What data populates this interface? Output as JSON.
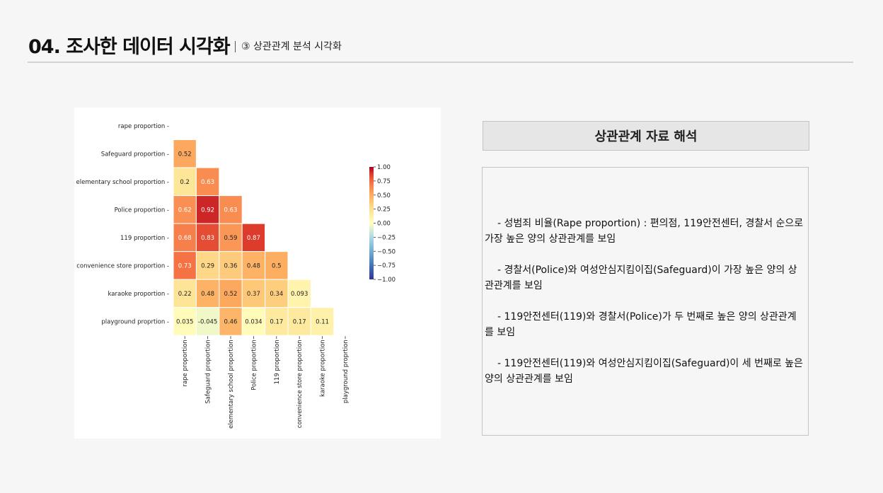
{
  "header": {
    "title": "04. 조사한 데이터 시각화",
    "subtitle": "③ 상관관계 분석 시각화"
  },
  "interpretation": {
    "heading": "상관관계 자료 해석",
    "notes": [
      "-  성범죄 비율(Rape proportion) : 편의점, 119안전센터, 경찰서 순으로 가장 높은 양의 상관관계를 보임",
      "-  경찰서(Police)와 여성안심지킴이집(Safeguard)이 가장 높은 양의 상관관계를 보임",
      "-  119안전센터(119)와 경찰서(Police)가 두 번째로 높은 양의 상관관계를 보임",
      "-  119안전센터(119)와 여성안심지킴이집(Safeguard)이 세 번째로 높은 양의 상관관계를 보임"
    ]
  },
  "chart_data": {
    "type": "heatmap",
    "title": "",
    "variables": [
      "rape proportion",
      "Safeguard proportion",
      "elementary school proportion",
      "Police proportion",
      "119 proportion",
      "convenience store proportion",
      "karaoke proportion",
      "playground proprtion"
    ],
    "cells": [
      {
        "row": 1,
        "col": 0,
        "value": 0.52,
        "label": "0.52"
      },
      {
        "row": 2,
        "col": 0,
        "value": 0.2,
        "label": "0.2"
      },
      {
        "row": 2,
        "col": 1,
        "value": 0.63,
        "label": "0.63"
      },
      {
        "row": 3,
        "col": 0,
        "value": 0.62,
        "label": "0.62"
      },
      {
        "row": 3,
        "col": 1,
        "value": 0.92,
        "label": "0.92"
      },
      {
        "row": 3,
        "col": 2,
        "value": 0.63,
        "label": "0.63"
      },
      {
        "row": 4,
        "col": 0,
        "value": 0.68,
        "label": "0.68"
      },
      {
        "row": 4,
        "col": 1,
        "value": 0.83,
        "label": "0.83"
      },
      {
        "row": 4,
        "col": 2,
        "value": 0.59,
        "label": "0.59"
      },
      {
        "row": 4,
        "col": 3,
        "value": 0.87,
        "label": "0.87"
      },
      {
        "row": 5,
        "col": 0,
        "value": 0.73,
        "label": "0.73"
      },
      {
        "row": 5,
        "col": 1,
        "value": 0.29,
        "label": "0.29"
      },
      {
        "row": 5,
        "col": 2,
        "value": 0.36,
        "label": "0.36"
      },
      {
        "row": 5,
        "col": 3,
        "value": 0.48,
        "label": "0.48"
      },
      {
        "row": 5,
        "col": 4,
        "value": 0.5,
        "label": "0.5"
      },
      {
        "row": 6,
        "col": 0,
        "value": 0.22,
        "label": "0.22"
      },
      {
        "row": 6,
        "col": 1,
        "value": 0.48,
        "label": "0.48"
      },
      {
        "row": 6,
        "col": 2,
        "value": 0.52,
        "label": "0.52"
      },
      {
        "row": 6,
        "col": 3,
        "value": 0.37,
        "label": "0.37"
      },
      {
        "row": 6,
        "col": 4,
        "value": 0.34,
        "label": "0.34"
      },
      {
        "row": 6,
        "col": 5,
        "value": 0.093,
        "label": "0.093"
      },
      {
        "row": 7,
        "col": 0,
        "value": 0.035,
        "label": "0.035"
      },
      {
        "row": 7,
        "col": 1,
        "value": -0.045,
        "label": "-0.045"
      },
      {
        "row": 7,
        "col": 2,
        "value": 0.46,
        "label": "0.46"
      },
      {
        "row": 7,
        "col": 3,
        "value": 0.034,
        "label": "0.034"
      },
      {
        "row": 7,
        "col": 4,
        "value": 0.17,
        "label": "0.17"
      },
      {
        "row": 7,
        "col": 5,
        "value": 0.17,
        "label": "0.17"
      },
      {
        "row": 7,
        "col": 6,
        "value": 0.11,
        "label": "0.11"
      }
    ],
    "color_scale": {
      "range": [
        -1,
        1
      ],
      "colormap": "RdYlBu_r",
      "ticks": [
        "1.00",
        "0.75",
        "0.50",
        "0.25",
        "0.00",
        "−0.25",
        "−0.50",
        "−0.75",
        "−1.00"
      ],
      "tick_values": [
        1.0,
        0.75,
        0.5,
        0.25,
        0.0,
        -0.25,
        -0.5,
        -0.75,
        -1.0
      ]
    },
    "mask": "upper triangle including diagonal",
    "cell_border_color": "#ffffff"
  }
}
